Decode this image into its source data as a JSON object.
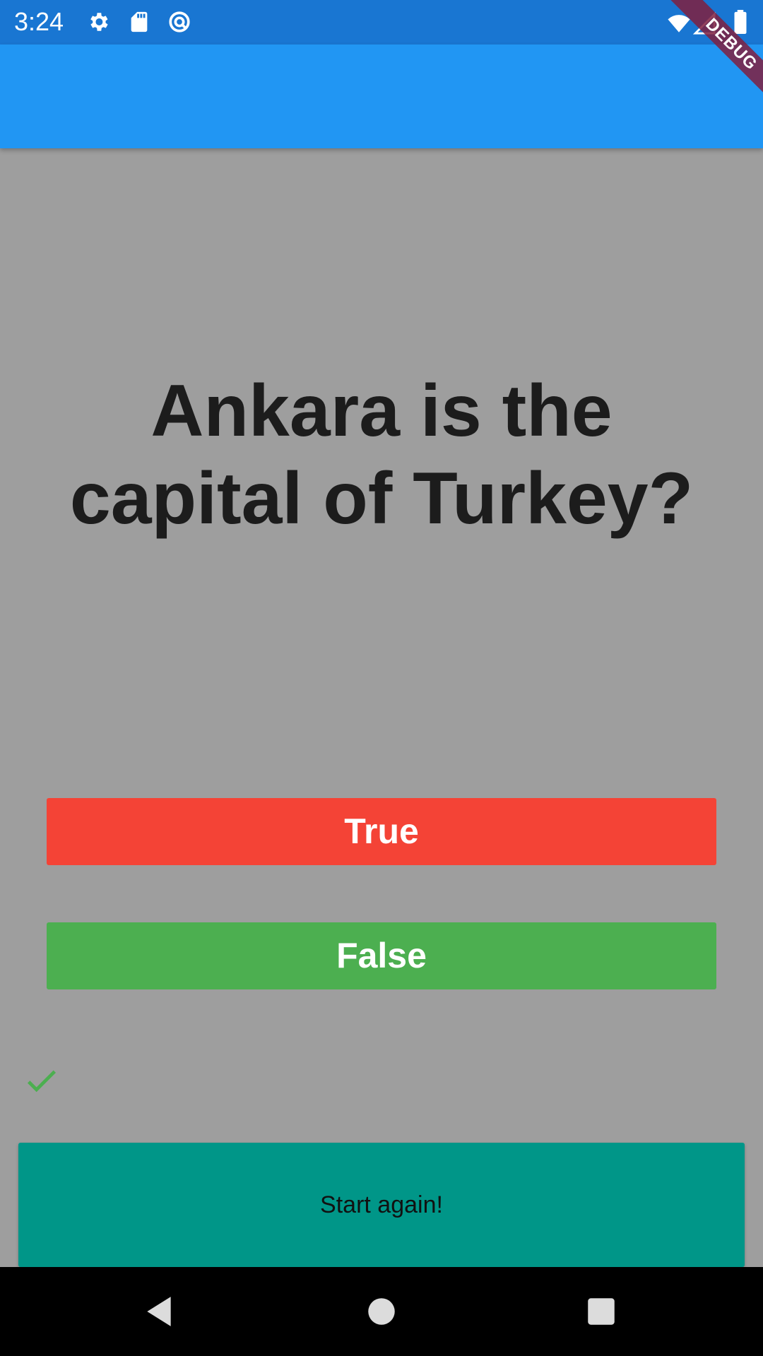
{
  "status_bar": {
    "time": "3:24",
    "icons": [
      "gear-icon",
      "sd-card-icon",
      "sync-icon",
      "wifi-icon",
      "signal-icon",
      "battery-icon"
    ]
  },
  "debug_banner": "DEBUG",
  "question": "Ankara is the capital of Turkey?",
  "buttons": {
    "true_label": "True",
    "false_label": "False",
    "start_again_label": "Start again!"
  },
  "score": {
    "icons": [
      "check-icon"
    ]
  },
  "colors": {
    "status_bar": "#1976d2",
    "app_bar": "#2196f3",
    "background": "#9e9e9e",
    "true_button": "#f44336",
    "false_button": "#4caf50",
    "start_again": "#009688",
    "check": "#4caf50"
  },
  "nav_bar": {
    "icons": [
      "back-icon",
      "home-icon",
      "recents-icon"
    ]
  }
}
